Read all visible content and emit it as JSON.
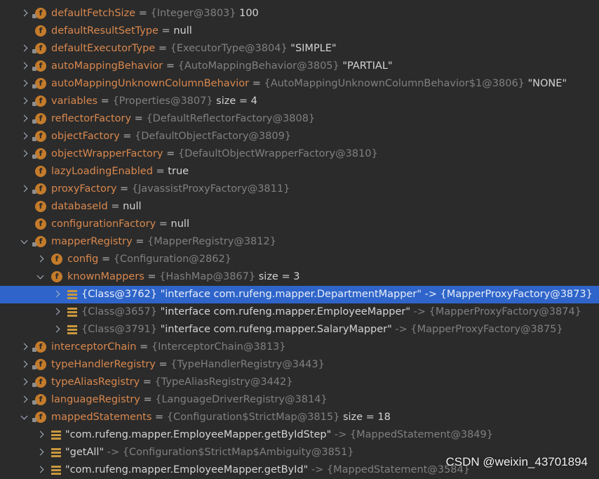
{
  "rows": [
    {
      "kind": "f",
      "arrow": "collapsed",
      "name": "defaultFetchSize",
      "eq": " = ",
      "ref": "{Integer@3803}",
      "val": " 100"
    },
    {
      "kind": "f",
      "arrow": "",
      "name": "defaultResultSetType",
      "eq": " = ",
      "ref": "",
      "val": "null"
    },
    {
      "kind": "f",
      "arrow": "collapsed",
      "name": "defaultExecutorType",
      "eq": " = ",
      "ref": "{ExecutorType@3804}",
      "val": " \"SIMPLE\""
    },
    {
      "kind": "f",
      "arrow": "collapsed",
      "name": "autoMappingBehavior",
      "eq": " = ",
      "ref": "{AutoMappingBehavior@3805}",
      "val": " \"PARTIAL\""
    },
    {
      "kind": "f",
      "arrow": "collapsed",
      "name": "autoMappingUnknownColumnBehavior",
      "eq": " = ",
      "ref": "{AutoMappingUnknownColumnBehavior$1@3806}",
      "val": " \"NONE\""
    },
    {
      "kind": "f",
      "arrow": "collapsed",
      "name": "variables",
      "eq": " = ",
      "ref": "{Properties@3807}",
      "val": "  size = 4"
    },
    {
      "kind": "f",
      "arrow": "collapsed",
      "name": "reflectorFactory",
      "eq": " = ",
      "ref": "{DefaultReflectorFactory@3808}",
      "val": ""
    },
    {
      "kind": "f",
      "arrow": "collapsed",
      "name": "objectFactory",
      "eq": " = ",
      "ref": "{DefaultObjectFactory@3809}",
      "val": ""
    },
    {
      "kind": "f",
      "arrow": "collapsed",
      "name": "objectWrapperFactory",
      "eq": " = ",
      "ref": "{DefaultObjectWrapperFactory@3810}",
      "val": ""
    },
    {
      "kind": "f",
      "arrow": "",
      "name": "lazyLoadingEnabled",
      "eq": " = ",
      "ref": "",
      "val": "true"
    },
    {
      "kind": "f",
      "arrow": "collapsed",
      "name": "proxyFactory",
      "eq": " = ",
      "ref": "{JavassistProxyFactory@3811}",
      "val": ""
    },
    {
      "kind": "f",
      "arrow": "",
      "name": "databaseId",
      "eq": " = ",
      "ref": "",
      "val": "null"
    },
    {
      "kind": "f",
      "arrow": "",
      "name": "configurationFactory",
      "eq": " = ",
      "ref": "",
      "val": "null"
    },
    {
      "kind": "f",
      "arrow": "expanded",
      "name": "mapperRegistry",
      "eq": " = ",
      "ref": "{MapperRegistry@3812}",
      "val": ""
    },
    {
      "kind": "f",
      "arrow": "collapsed",
      "indent": 1,
      "name": "config",
      "eq": " = ",
      "ref": "{Configuration@2862}",
      "val": ""
    },
    {
      "kind": "f",
      "arrow": "expanded",
      "indent": 1,
      "name": "knownMappers",
      "eq": " = ",
      "ref": "{HashMap@3867}",
      "val": "  size = 3"
    },
    {
      "kind": "l",
      "arrow": "collapsed",
      "indent": 2,
      "sel": true,
      "name": "",
      "eq": "",
      "ref": "{Class@3762}",
      "val": " \"interface com.rufeng.mapper.DepartmentMapper\" -> {MapperProxyFactory@3873}"
    },
    {
      "kind": "l",
      "arrow": "collapsed",
      "indent": 2,
      "name": "",
      "eq": "",
      "ref": "{Class@3657}",
      "val": " \"interface com.rufeng.mapper.EmployeeMapper\"",
      "tail": " -> {MapperProxyFactory@3874}"
    },
    {
      "kind": "l",
      "arrow": "collapsed",
      "indent": 2,
      "name": "",
      "eq": "",
      "ref": "{Class@3791}",
      "val": " \"interface com.rufeng.mapper.SalaryMapper\"",
      "tail": " -> {MapperProxyFactory@3875}"
    },
    {
      "kind": "f",
      "arrow": "collapsed",
      "name": "interceptorChain",
      "eq": " = ",
      "ref": "{InterceptorChain@3813}",
      "val": ""
    },
    {
      "kind": "f",
      "arrow": "collapsed",
      "name": "typeHandlerRegistry",
      "eq": " = ",
      "ref": "{TypeHandlerRegistry@3443}",
      "val": ""
    },
    {
      "kind": "f",
      "arrow": "collapsed",
      "name": "typeAliasRegistry",
      "eq": " = ",
      "ref": "{TypeAliasRegistry@3442}",
      "val": ""
    },
    {
      "kind": "f",
      "arrow": "collapsed",
      "name": "languageRegistry",
      "eq": " = ",
      "ref": "{LanguageDriverRegistry@3814}",
      "val": ""
    },
    {
      "kind": "f",
      "arrow": "expanded",
      "name": "mappedStatements",
      "eq": " = ",
      "ref": "{Configuration$StrictMap@3815}",
      "val": "  size = 18"
    },
    {
      "kind": "l",
      "arrow": "collapsed",
      "indent": 1,
      "name": "",
      "eq": "",
      "ref": "",
      "val": "\"com.rufeng.mapper.EmployeeMapper.getByIdStep\"",
      "tail": " -> {MappedStatement@3849}"
    },
    {
      "kind": "l",
      "arrow": "collapsed",
      "indent": 1,
      "name": "",
      "eq": "",
      "ref": "",
      "val": "\"getAll\"",
      "tail": " -> {Configuration$StrictMap$Ambiguity@3851}"
    },
    {
      "kind": "l",
      "arrow": "collapsed",
      "indent": 1,
      "name": "",
      "eq": "",
      "ref": "",
      "val": "\"com.rufeng.mapper.EmployeeMapper.getById\"",
      "tail": " -> {MappedStatement@3584}"
    }
  ],
  "watermark": "CSDN @weixin_43701894"
}
